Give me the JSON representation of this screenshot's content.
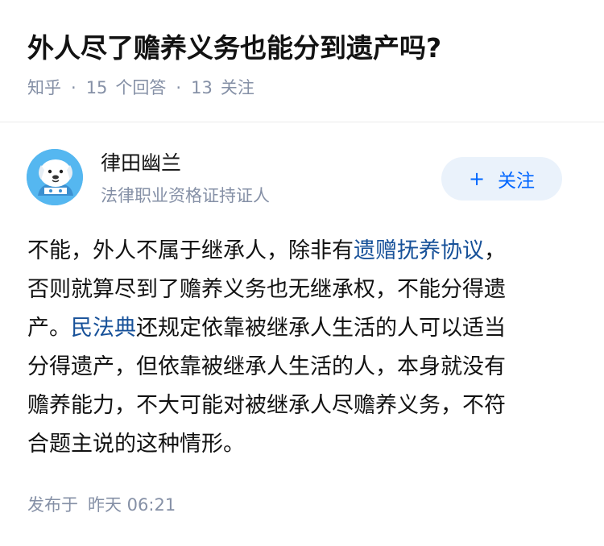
{
  "question": {
    "title": "外人尽了赡养义务也能分到遗产吗?",
    "source": "知乎",
    "answer_count": "15",
    "answer_label": "个回答",
    "follower_count": "13",
    "follower_label": "关注"
  },
  "author": {
    "name": "律田幽兰",
    "badge": "法律职业资格证持证人",
    "follow_plus": "+",
    "follow_label": "关注"
  },
  "answer": {
    "line1_pre": "不能，外人不属于继承人，除非有",
    "line1_link": "遗赠抚养协议",
    "line1_post": "，",
    "line2": "否则就算尽到了赡养义务也无继承权，不能分得遗",
    "line3_pre": "产。",
    "line3_link": "民法典",
    "line3_post": "还规定依靠被继承人生活的人可以适当",
    "line4": "分得遗产，但依靠被继承人生活的人，本身就没有",
    "line5": "赡养能力，不大可能对被继承人尽赡养义务，不符",
    "line6": "合题主说的这种情形。"
  },
  "footer": {
    "published_label": "发布于",
    "published_time": "昨天 06:21"
  },
  "colors": {
    "accent": "#0066ff",
    "link": "#175199",
    "meta": "#8590a6",
    "follow_bg": "#eaf2fb",
    "avatar_bg": "#55b7f0"
  },
  "icons": {
    "avatar": "dog-avatar-icon"
  }
}
